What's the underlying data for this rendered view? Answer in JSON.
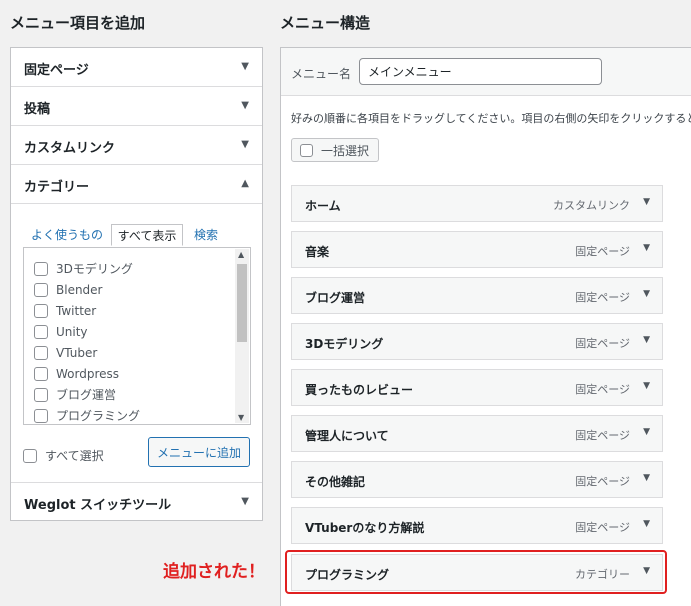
{
  "left": {
    "heading": "メニュー項目を追加",
    "sections": [
      {
        "label": "固定ページ",
        "arrow": "▼"
      },
      {
        "label": "投稿",
        "arrow": "▼"
      },
      {
        "label": "カスタムリンク",
        "arrow": "▼"
      },
      {
        "label": "カテゴリー",
        "arrow": "▲"
      }
    ],
    "tabs": {
      "frequent": "よく使うもの",
      "all": "すべて表示",
      "search": "検索"
    },
    "categories": [
      "3Dモデリング",
      "Blender",
      "Twitter",
      "Unity",
      "VTuber",
      "Wordpress",
      "ブログ運営",
      "プログラミング"
    ],
    "select_all": "すべて選択",
    "add_button": "メニューに追加",
    "last_section": {
      "label": "Weglot スイッチツール",
      "arrow": "▼"
    }
  },
  "right": {
    "heading": "メニュー構造",
    "menu_name_label": "メニュー名",
    "menu_name_value": "メインメニュー",
    "instructions": "好みの順番に各項目をドラッグしてください。項目の右側の矢印をクリックすると",
    "bulk_select": "一括選択",
    "items": [
      {
        "title": "ホーム",
        "type": "カスタムリンク"
      },
      {
        "title": "音楽",
        "type": "固定ページ"
      },
      {
        "title": "ブログ運営",
        "type": "固定ページ"
      },
      {
        "title": "3Dモデリング",
        "type": "固定ページ"
      },
      {
        "title": "買ったものレビュー",
        "type": "固定ページ"
      },
      {
        "title": "管理人について",
        "type": "固定ページ"
      },
      {
        "title": "その他雑記",
        "type": "固定ページ"
      },
      {
        "title": "VTuberのなり方解説",
        "type": "固定ページ"
      },
      {
        "title": "プログラミング",
        "type": "カテゴリー"
      }
    ],
    "item_arrow": "▼"
  },
  "annotation": "追加された！",
  "colors": {
    "highlight": "#e02020",
    "link": "#2271b1"
  }
}
